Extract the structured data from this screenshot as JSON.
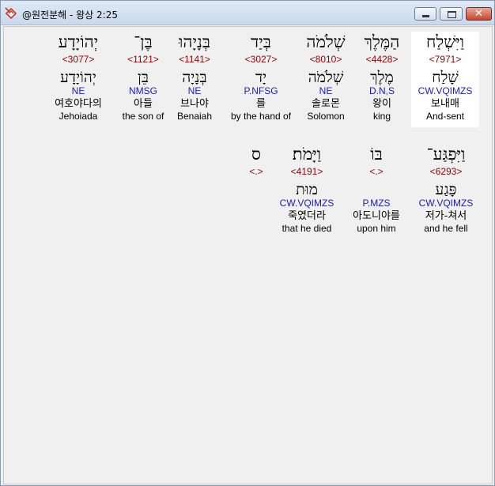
{
  "window": {
    "title": "@원전분해 - 왕상 2:25",
    "minimize_label": "",
    "maximize_label": "",
    "close_label": "✕"
  },
  "colors": {
    "strong_number": "#990000",
    "morph_code": "#1a1acc"
  },
  "rows": [
    [
      {
        "hebrew": "וַיִּשְׁלַח",
        "strong": "<7971>",
        "lexeme": "שָׁלַח",
        "morph": "CW.VQIMZS",
        "korean": "보내매",
        "english": "And-sent"
      },
      {
        "hebrew": "הַמֶּלֶךְ",
        "strong": "<4428>",
        "lexeme": "מֶלֶךְ",
        "morph": "D.N,S",
        "korean": "왕이",
        "english": "king"
      },
      {
        "hebrew": "שְׁלֹמֹה",
        "strong": "<8010>",
        "lexeme": "שְׁלֹמֹה",
        "morph": "NE",
        "korean": "솔로몬",
        "english": "Solomon"
      },
      {
        "hebrew": "בְּיַד",
        "strong": "<3027>",
        "lexeme": "יָד",
        "morph": "P.NFSG",
        "korean": "를",
        "english": "by the hand of"
      },
      {
        "hebrew": "בְּנָיָהוּ",
        "strong": "<1141>",
        "lexeme": "בְּנָיָה",
        "morph": "NE",
        "korean": "브나야",
        "english": "Benaiah"
      },
      {
        "hebrew": "בֶּן־",
        "strong": "<1121>",
        "lexeme": "בֵּן",
        "morph": "NMSG",
        "korean": "아들",
        "english": "the son of"
      },
      {
        "hebrew": "יְהוֹיָדָע",
        "strong": "<3077>",
        "lexeme": "יְהוֹיָדָע",
        "morph": "NE",
        "korean": "여호야다의",
        "english": "Jehoiada"
      }
    ],
    [
      {
        "hebrew": "וַיִּפְגַּע־",
        "strong": "<6293>",
        "lexeme": "פָּגַע",
        "morph": "CW.VQIMZS",
        "korean": "저가-쳐서",
        "english": "and he fell"
      },
      {
        "hebrew": "בּוֹ",
        "strong": "<.>",
        "lexeme": "",
        "morph": "P.MZS",
        "korean": "아도니야를",
        "english": "upon him"
      },
      {
        "hebrew": "וַיָּמֹת׃",
        "strong": "<4191>",
        "lexeme": "מוּת",
        "morph": "CW.VQIMZS",
        "korean": "죽였더라",
        "english": "that he died"
      },
      {
        "hebrew": "ס",
        "strong": "<.>",
        "lexeme": "",
        "morph": "",
        "korean": "",
        "english": ""
      }
    ]
  ]
}
